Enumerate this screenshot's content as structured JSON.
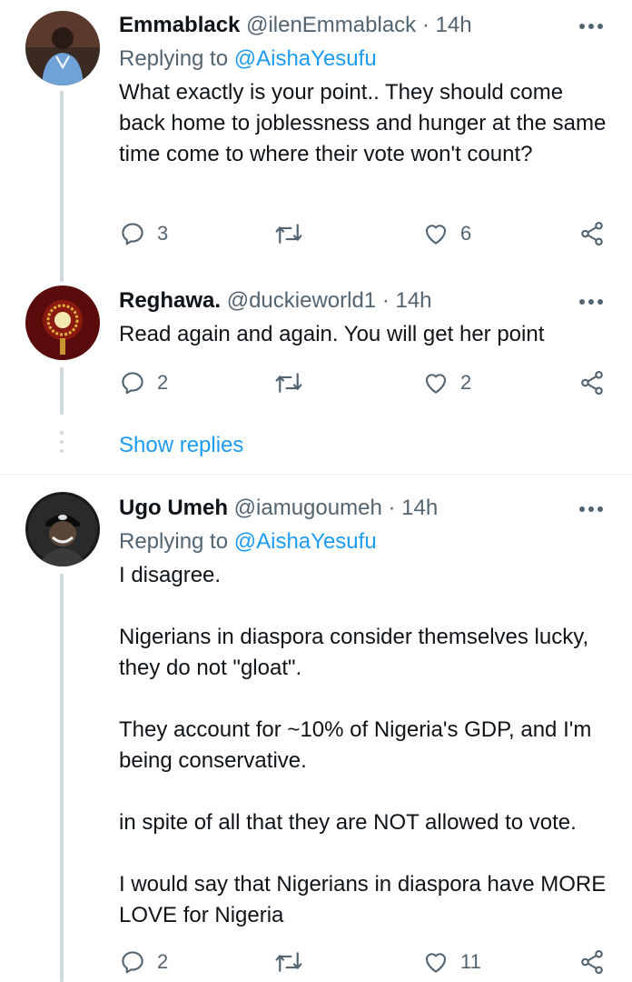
{
  "tweets": [
    {
      "name": "Emmablack",
      "handle": "@ilenEmmablack",
      "dot": "·",
      "time": "14h",
      "replying_prefix": "Replying to ",
      "replying_to": "@AishaYesufu",
      "body": [
        "What exactly is your point.. They should come back home to joblessness and hunger at the same time come to where their vote won't count?"
      ],
      "replies": "3",
      "retweets": "",
      "likes": "6"
    },
    {
      "name": "Reghawa.",
      "handle": "@duckieworld1",
      "dot": "·",
      "time": "14h",
      "body": [
        "Read again and again. You will get her point"
      ],
      "replies": "2",
      "retweets": "",
      "likes": "2"
    },
    {
      "name": "Ugo Umeh",
      "handle": "@iamugoumeh",
      "dot": "·",
      "time": "14h",
      "replying_prefix": "Replying to ",
      "replying_to": "@AishaYesufu",
      "body": [
        "I disagree.",
        "Nigerians in diaspora consider themselves lucky, they do not \"gloat\".",
        "They account for ~10% of Nigeria's GDP, and I'm being conservative.",
        "in spite of all that they are NOT allowed to vote.",
        "I would say that Nigerians in diaspora have MORE LOVE for Nigeria"
      ],
      "replies": "2",
      "retweets": "",
      "likes": "11"
    }
  ],
  "show_replies": "Show replies",
  "colors": {
    "link": "#1d9bf0",
    "secondary": "#536471",
    "text": "#0f1419",
    "line": "#cfd9de"
  },
  "icons": [
    "reply-icon",
    "retweet-icon",
    "like-icon",
    "share-icon",
    "more-icon"
  ]
}
